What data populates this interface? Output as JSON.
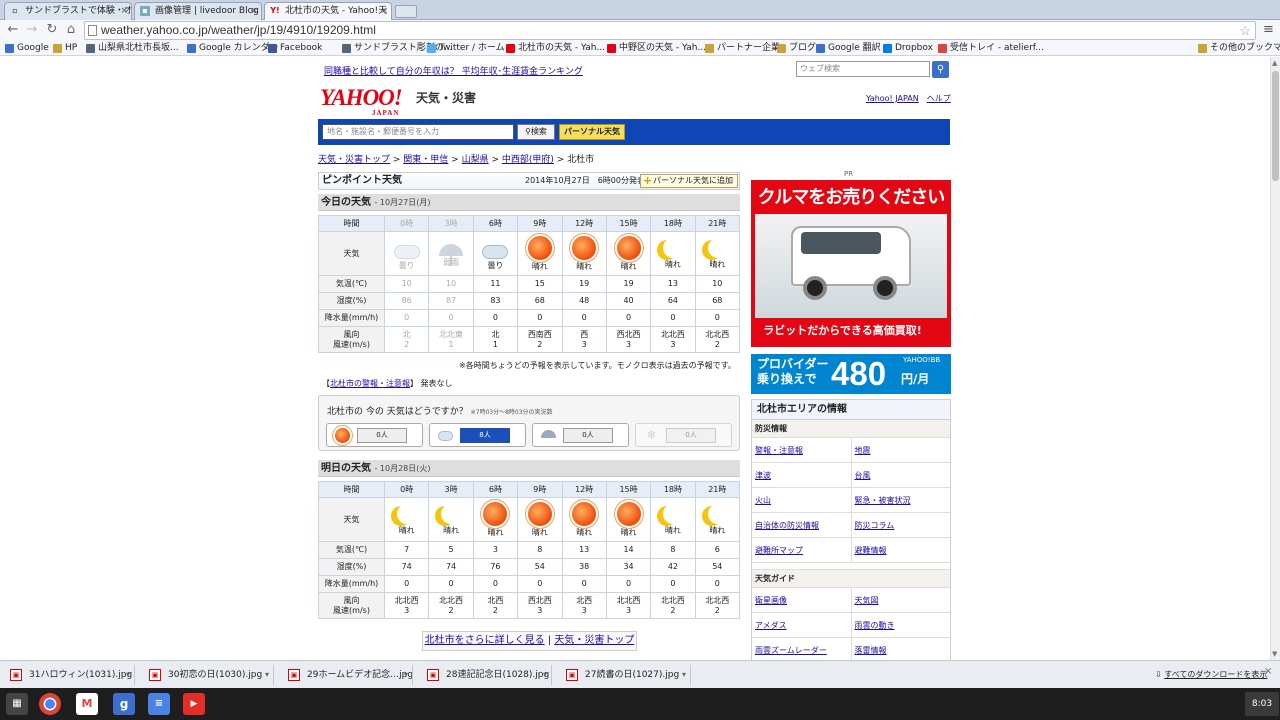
{
  "browser": {
    "tabs": [
      {
        "title": "サンドブラストで体験・オリジナ",
        "active": false
      },
      {
        "title": "画像管理 | livedoor Blog",
        "active": false
      },
      {
        "title": "北杜市の天気 - Yahoo!天",
        "active": true
      }
    ],
    "url": "weather.yahoo.co.jp/weather/jp/19/4910/19209.html",
    "bookmarks": [
      {
        "label": "Google",
        "icon": "google-icon"
      },
      {
        "label": "HP",
        "icon": "folder-icon"
      },
      {
        "label": "山梨県北杜市長坂...",
        "icon": "site-icon"
      },
      {
        "label": "Google カレンダー",
        "icon": "calendar-icon"
      },
      {
        "label": "Facebook",
        "icon": "facebook-icon"
      },
      {
        "label": "サンドブラスト彫刻の...",
        "icon": "site-icon"
      },
      {
        "label": "Twitter / ホーム",
        "icon": "twitter-icon"
      },
      {
        "label": "北杜市の天気 - Yah...",
        "icon": "yahoo-icon"
      },
      {
        "label": "中野区の天気 - Yah...",
        "icon": "yahoo-icon"
      },
      {
        "label": "パートナー企業",
        "icon": "folder-icon"
      },
      {
        "label": "ブログ",
        "icon": "folder-icon"
      },
      {
        "label": "Google 翻訳",
        "icon": "translate-icon"
      },
      {
        "label": "Dropbox",
        "icon": "dropbox-icon"
      },
      {
        "label": "受信トレイ - atelierf...",
        "icon": "gmail-icon"
      },
      {
        "label": "その他のブックマーク",
        "icon": "folder-icon"
      }
    ]
  },
  "header": {
    "top_link": "同職種と比較して自分の年収は？ 平均年収･生涯賃金ランキング",
    "websearch_placeholder": "ウェブ検索",
    "logo": "YAHOO!",
    "logo_sub": "JAPAN",
    "service": "天気・災害",
    "link_yahoo": "Yahoo! JAPAN",
    "link_help": "ヘルプ",
    "addr_placeholder": "地名・施設名・郵便番号を入力",
    "search_btn": "検索",
    "personal_btn": "パーソナル天気"
  },
  "breadcrumb": [
    "天気・災害トップ",
    "関東・甲信",
    "山梨県",
    "中西部(甲府)",
    "北杜市"
  ],
  "pinpoint": {
    "title": "ピンポイント天気",
    "published": "2014年10月27日　6時00分発表",
    "add_btn": "パーソナル天気に追加"
  },
  "today": {
    "title": "今日の天気",
    "date": "- 10月27日(月)",
    "labels": {
      "time": "時間",
      "weather": "天気",
      "temp": "気温(℃)",
      "humid": "湿度(%)",
      "rain": "降水量(mm/h)",
      "wind1": "風向",
      "wind2": "風速(m/s)"
    },
    "cols": [
      {
        "time": "0時",
        "icon": "cloud",
        "w": "曇り",
        "temp": "10",
        "humid": "86",
        "rain": "0",
        "dir": "北",
        "speed": "2",
        "past": true
      },
      {
        "time": "3時",
        "icon": "umbrella",
        "w": "弱雨",
        "temp": "10",
        "humid": "87",
        "rain": "0",
        "dir": "北北東",
        "speed": "1",
        "past": true
      },
      {
        "time": "6時",
        "icon": "cloud",
        "w": "曇り",
        "temp": "11",
        "humid": "83",
        "rain": "0",
        "dir": "北",
        "speed": "1",
        "past": false
      },
      {
        "time": "9時",
        "icon": "sun",
        "w": "晴れ",
        "temp": "15",
        "humid": "68",
        "rain": "0",
        "dir": "西南西",
        "speed": "2",
        "past": false
      },
      {
        "time": "12時",
        "icon": "sun",
        "w": "晴れ",
        "temp": "19",
        "humid": "48",
        "rain": "0",
        "dir": "西",
        "speed": "3",
        "past": false
      },
      {
        "time": "15時",
        "icon": "sun",
        "w": "晴れ",
        "temp": "19",
        "humid": "40",
        "rain": "0",
        "dir": "西北西",
        "speed": "3",
        "past": false
      },
      {
        "time": "18時",
        "icon": "moon",
        "w": "晴れ",
        "temp": "13",
        "humid": "64",
        "rain": "0",
        "dir": "北北西",
        "speed": "3",
        "past": false
      },
      {
        "time": "21時",
        "icon": "moon",
        "w": "晴れ",
        "temp": "10",
        "humid": "68",
        "rain": "0",
        "dir": "北北西",
        "speed": "2",
        "past": false
      }
    ]
  },
  "note": "※各時間ちょうどの予報を表示しています。モノクロ表示は過去の予報です。",
  "warning": {
    "link": "北杜市の警報・注意報",
    "status": "発表なし"
  },
  "vote": {
    "question": "北杜市の 今の 天気はどうですか？",
    "question_small": "※7時03分～8時03分の実況数",
    "options": [
      {
        "icon": "sun",
        "count": "0人"
      },
      {
        "icon": "cloud",
        "count": "8人"
      },
      {
        "icon": "rain",
        "count": "0人"
      },
      {
        "icon": "snow",
        "count": "0人"
      }
    ]
  },
  "tomorrow": {
    "title": "明日の天気",
    "date": "- 10月28日(火)",
    "cols": [
      {
        "time": "0時",
        "icon": "moon",
        "w": "晴れ",
        "temp": "7",
        "humid": "74",
        "rain": "0",
        "dir": "北北西",
        "speed": "3"
      },
      {
        "time": "3時",
        "icon": "moon",
        "w": "晴れ",
        "temp": "5",
        "humid": "74",
        "rain": "0",
        "dir": "北北西",
        "speed": "2"
      },
      {
        "time": "6時",
        "icon": "sun",
        "w": "晴れ",
        "temp": "3",
        "humid": "76",
        "rain": "0",
        "dir": "北西",
        "speed": "2"
      },
      {
        "time": "9時",
        "icon": "sun",
        "w": "晴れ",
        "temp": "8",
        "humid": "54",
        "rain": "0",
        "dir": "西北西",
        "speed": "3"
      },
      {
        "time": "12時",
        "icon": "sun",
        "w": "晴れ",
        "temp": "13",
        "humid": "38",
        "rain": "0",
        "dir": "北西",
        "speed": "3"
      },
      {
        "time": "15時",
        "icon": "sun",
        "w": "晴れ",
        "temp": "14",
        "humid": "34",
        "rain": "0",
        "dir": "北北西",
        "speed": "3"
      },
      {
        "time": "18時",
        "icon": "moon",
        "w": "晴れ",
        "temp": "8",
        "humid": "42",
        "rain": "0",
        "dir": "北北西",
        "speed": "2"
      },
      {
        "time": "21時",
        "icon": "moon",
        "w": "晴れ",
        "temp": "6",
        "humid": "54",
        "rain": "0",
        "dir": "北北西",
        "speed": "2"
      }
    ]
  },
  "more": {
    "detail": "北杜市をさらに詳しく見る",
    "top": "天気・災害トップ"
  },
  "ads": {
    "pr": "PR",
    "ad1_head": "クルマをお売りください",
    "ad1_foot": "ラビットだからできる高価買取!",
    "ad2_line1": "プロバイダー",
    "ad2_line2": "乗り換えで",
    "ad2_num": "480",
    "ad2_unit": "円/月",
    "ad2_brand": "YAHOO!BB"
  },
  "area": {
    "title": "北杜市エリアの情報",
    "cat1": "防災情報",
    "rows1": [
      [
        "警報・注意報",
        "地震"
      ],
      [
        "津波",
        "台風"
      ],
      [
        "火山",
        "緊急・被害状況"
      ],
      [
        "自治体の防災情報",
        "防災コラム"
      ],
      [
        "避難所マップ",
        "避難情報"
      ]
    ],
    "cat2": "天気ガイド",
    "rows2": [
      [
        "衛星画像",
        "天気図"
      ],
      [
        "アメダス",
        "雨雲の動き"
      ],
      [
        "雨雲ズームレーダー",
        "落雷情報"
      ]
    ]
  },
  "downloads": [
    {
      "name": "31ハロウィン(1031).jpg"
    },
    {
      "name": "30初恋の日(1030).jpg"
    },
    {
      "name": "29ホームビデオ記念…jpg"
    },
    {
      "name": "28速記記念日(1028).jpg"
    },
    {
      "name": "27読書の日(1027).jpg"
    }
  ],
  "download_showall": "すべてのダウンロードを表示",
  "clock": "8:03"
}
